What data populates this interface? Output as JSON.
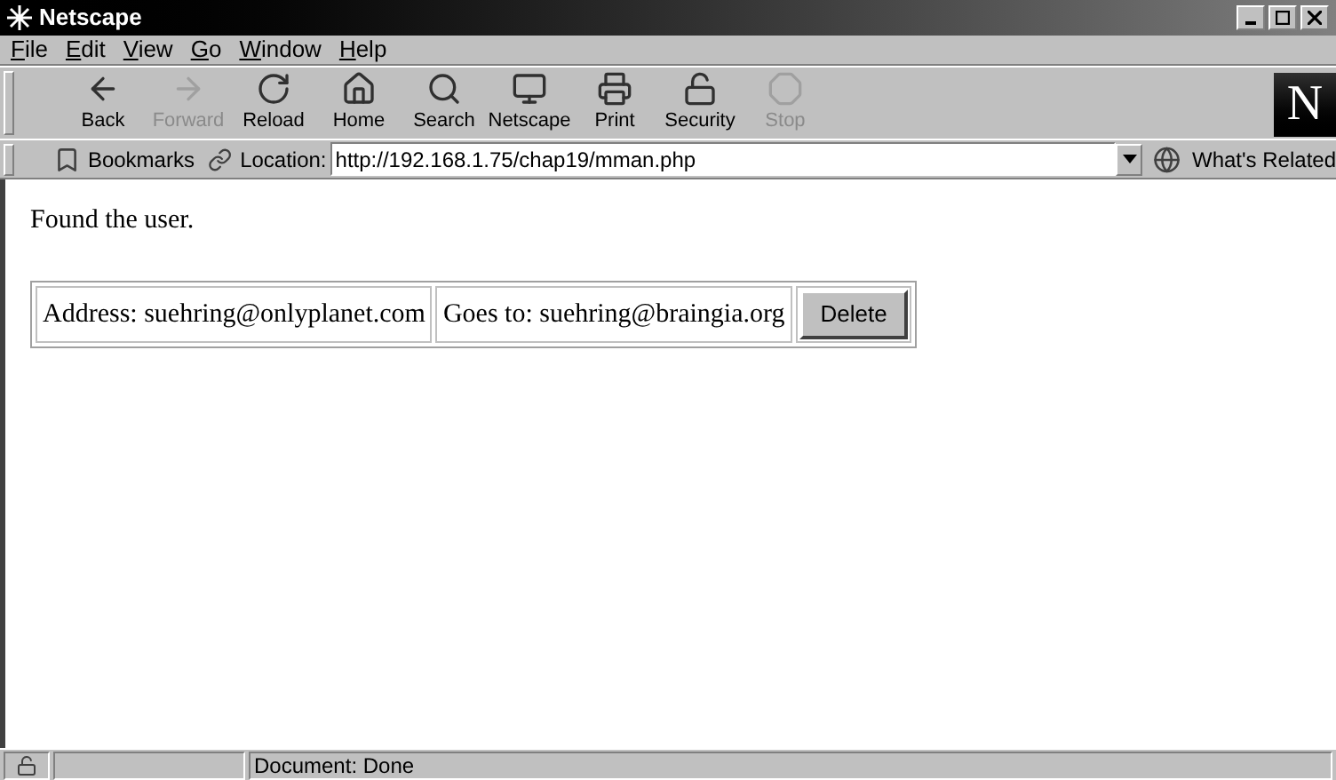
{
  "window": {
    "title": "Netscape"
  },
  "menu": [
    {
      "label": "File"
    },
    {
      "label": "Edit"
    },
    {
      "label": "View"
    },
    {
      "label": "Go"
    },
    {
      "label": "Window"
    },
    {
      "label": "Help"
    }
  ],
  "toolbar": [
    {
      "kind": "back",
      "label": "Back",
      "disabled": false
    },
    {
      "kind": "forward",
      "label": "Forward",
      "disabled": true
    },
    {
      "kind": "reload",
      "label": "Reload",
      "disabled": false
    },
    {
      "kind": "home",
      "label": "Home",
      "disabled": false
    },
    {
      "kind": "search",
      "label": "Search",
      "disabled": false
    },
    {
      "kind": "netscape",
      "label": "Netscape",
      "disabled": false
    },
    {
      "kind": "print",
      "label": "Print",
      "disabled": false
    },
    {
      "kind": "security",
      "label": "Security",
      "disabled": false
    },
    {
      "kind": "stop",
      "label": "Stop",
      "disabled": true
    }
  ],
  "logo": "N",
  "location_bar": {
    "bookmarks": "Bookmarks",
    "location_label": "Location:",
    "url": "http://192.168.1.75/chap19/mman.php",
    "whats_related": "What's Related"
  },
  "page": {
    "message": "Found the user.",
    "cells": [
      "Address: suehring@onlyplanet.com",
      "Goes to: suehring@braingia.org"
    ],
    "button": "Delete"
  },
  "status_bar": {
    "text": "Document: Done"
  }
}
